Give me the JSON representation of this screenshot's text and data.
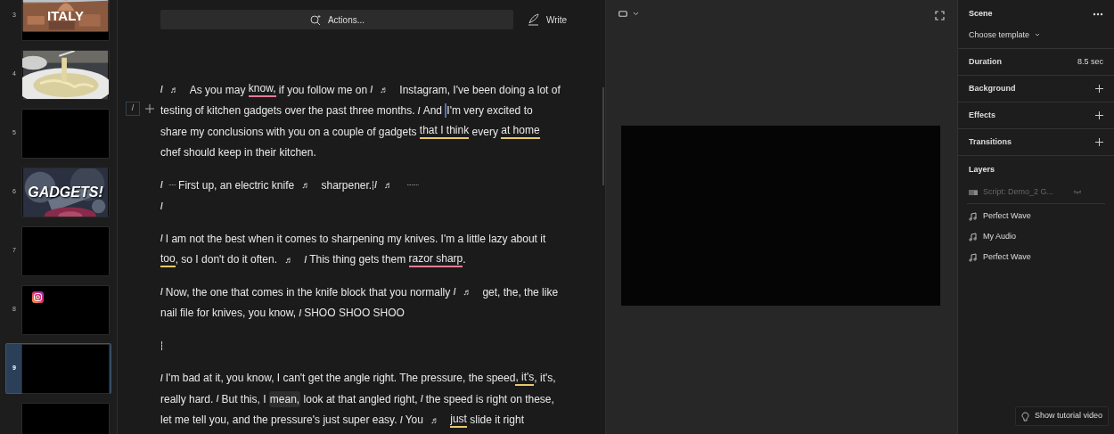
{
  "slides": [
    {
      "number": "3",
      "kind": "city",
      "title": "ITALY",
      "selected": false
    },
    {
      "number": "4",
      "kind": "pasta",
      "selected": false
    },
    {
      "number": "5",
      "kind": "blank",
      "selected": false
    },
    {
      "number": "6",
      "kind": "gears",
      "title": "GADGETS!",
      "selected": false
    },
    {
      "number": "7",
      "kind": "blank",
      "selected": false
    },
    {
      "number": "8",
      "kind": "instagram",
      "selected": false
    },
    {
      "number": "9",
      "kind": "blank",
      "selected": true
    },
    {
      "kind": "blank",
      "selected": false
    }
  ],
  "toolbar": {
    "actions": "Actions...",
    "write": "Write"
  },
  "gutter": {
    "marker": "/"
  },
  "script": [
    {
      "lines": [
        [
          {
            "kind": "mark",
            "text": "/"
          },
          {
            "kind": "note",
            "text": "♬"
          },
          {
            "kind": "text",
            "text": "As you may "
          },
          {
            "kind": "underline",
            "text": "know,",
            "color": "#e57b95"
          },
          {
            "kind": "text",
            "text": " if you follow me on "
          },
          {
            "kind": "mark",
            "text": "/"
          },
          {
            "kind": "note",
            "text": "♬"
          },
          {
            "kind": "text",
            "text": "Instagram, I've been doing a lot of"
          }
        ],
        [
          {
            "kind": "text",
            "text": "testing of kitchen gadgets over the past three months. "
          },
          {
            "kind": "mark",
            "text": "/"
          },
          {
            "kind": "text",
            "text": "And "
          },
          {
            "kind": "caret"
          },
          {
            "kind": "text",
            "text": "I'm very excited to"
          }
        ],
        [
          {
            "kind": "text",
            "text": "share my conclusions with you on a couple of gadgets "
          },
          {
            "kind": "underline",
            "text": "that I think",
            "color": "#e8c96a"
          },
          {
            "kind": "text",
            "text": " every "
          },
          {
            "kind": "underline",
            "text": "at home",
            "color": "#e8c96a"
          }
        ],
        [
          {
            "kind": "text",
            "text": "chef should keep in their kitchen."
          }
        ]
      ]
    },
    {
      "lines": [
        [
          {
            "kind": "mark",
            "text": "/"
          },
          {
            "kind": "dots",
            "text": "·····"
          },
          {
            "kind": "text",
            "text": "First up, an electric knife "
          },
          {
            "kind": "note",
            "text": "♬"
          },
          {
            "kind": "text",
            "text": "sharpener."
          },
          {
            "kind": "break"
          },
          {
            "kind": "mark",
            "text": "/"
          },
          {
            "kind": "note",
            "text": "♬"
          },
          {
            "kind": "dots",
            "text": "········"
          }
        ],
        [
          {
            "kind": "mark",
            "text": "/"
          }
        ]
      ]
    },
    {
      "lines": [
        [
          {
            "kind": "mark",
            "text": "/"
          },
          {
            "kind": "text",
            "text": "I am not the best when it comes to sharpening my knives. I'm a little lazy about it"
          }
        ],
        [
          {
            "kind": "underline",
            "text": "too",
            "color": "#e8c96a"
          },
          {
            "kind": "text",
            "text": ", so I don't do it often. "
          },
          {
            "kind": "note",
            "text": "♬"
          },
          {
            "kind": "mark",
            "text": "/"
          },
          {
            "kind": "text",
            "text": "This thing gets them "
          },
          {
            "kind": "underline",
            "text": "razor sharp",
            "color": "#e57b95"
          },
          {
            "kind": "text",
            "text": "."
          }
        ]
      ]
    },
    {
      "lines": [
        [
          {
            "kind": "mark",
            "text": "/"
          },
          {
            "kind": "text",
            "text": "Now, the one that comes in the knife block that you normally "
          },
          {
            "kind": "mark",
            "text": "/"
          },
          {
            "kind": "note",
            "text": "♬"
          },
          {
            "kind": "text",
            "text": "get, the, the like"
          }
        ],
        [
          {
            "kind": "text",
            "text": "nail file for knives, you know, "
          },
          {
            "kind": "mark",
            "text": "/"
          },
          {
            "kind": "text",
            "text": "SHOO SHOO SHOO"
          }
        ]
      ]
    },
    {
      "lines": [
        [
          {
            "kind": "break"
          }
        ]
      ]
    },
    {
      "lines": [
        [
          {
            "kind": "mark",
            "text": "/"
          },
          {
            "kind": "text",
            "text": "I'm bad at it, you know, I can't get the angle right. The pressure, the speed"
          },
          {
            "kind": "underline",
            "text": ", it's",
            "color": "#e8c96a"
          },
          {
            "kind": "text",
            "text": ", it's,"
          }
        ],
        [
          {
            "kind": "text",
            "text": "really hard. "
          },
          {
            "kind": "mark",
            "text": "/"
          },
          {
            "kind": "text",
            "text": "But this, I "
          },
          {
            "kind": "chip",
            "text": "mean,"
          },
          {
            "kind": "text",
            "text": " look at that angled right, "
          },
          {
            "kind": "mark",
            "text": "/"
          },
          {
            "kind": "text",
            "text": "the speed is right on these,"
          }
        ],
        [
          {
            "kind": "text",
            "text": "let me tell you, and the pressure's just super easy. "
          },
          {
            "kind": "mark",
            "text": "/"
          },
          {
            "kind": "text",
            "text": "You "
          },
          {
            "kind": "note",
            "text": "♬"
          },
          {
            "kind": "underline",
            "text": "just",
            "color": "#e8c96a"
          },
          {
            "kind": "text",
            "text": " slide it right"
          }
        ]
      ]
    }
  ],
  "panel": {
    "scene": "Scene",
    "template": "Choose template",
    "rows": [
      {
        "kind": "value",
        "label": "Duration",
        "value": "8.5 sec"
      },
      {
        "kind": "add",
        "label": "Background"
      },
      {
        "kind": "add",
        "label": "Effects"
      },
      {
        "kind": "add",
        "label": "Transitions"
      }
    ],
    "layers_title": "Layers",
    "layers": [
      {
        "kind": "script",
        "name": "Script: Demo_2 G...",
        "disabled": true
      },
      {
        "kind": "audio",
        "name": "Perfect Wave",
        "disabled": false
      },
      {
        "kind": "audio",
        "name": "My Audio",
        "disabled": false
      },
      {
        "kind": "audio",
        "name": "Perfect Wave",
        "disabled": false
      }
    ],
    "tutorial": "Show tutorial video"
  }
}
